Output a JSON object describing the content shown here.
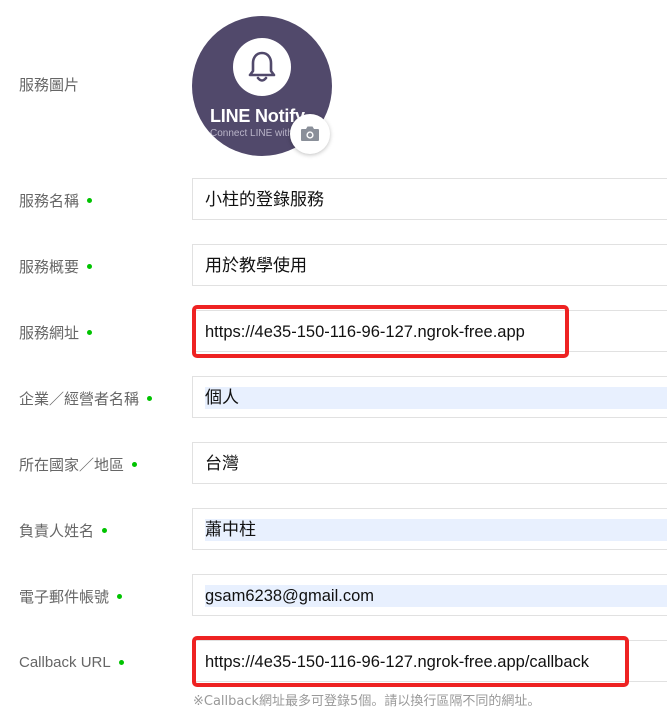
{
  "service_image": {
    "label": "服務圖片",
    "logo_text": "LINE Notify",
    "logo_tagline": "Connect LINE with Everything",
    "logo_icon": "bell-icon",
    "upload_icon": "camera-icon"
  },
  "fields": {
    "service_name": {
      "label": "服務名稱",
      "value": "小柱的登錄服務",
      "required": true
    },
    "service_summary": {
      "label": "服務概要",
      "value": "用於教學使用",
      "required": true
    },
    "service_url": {
      "label": "服務網址",
      "value": "https://4e35-150-116-96-127.ngrok-free.app",
      "required": true
    },
    "company_name": {
      "label": "企業／經營者名稱",
      "value": "個人",
      "required": true
    },
    "country": {
      "label": "所在國家／地區",
      "value": "台灣",
      "required": true
    },
    "contact_name": {
      "label": "負責人姓名",
      "value": "蕭中柱",
      "required": true
    },
    "email": {
      "label": "電子郵件帳號",
      "value": "gsam6238@gmail.com",
      "required": true
    },
    "callback_url": {
      "label": "Callback URL",
      "value": "https://4e35-150-116-96-127.ngrok-free.app/callback",
      "required": true
    }
  },
  "callback_note": "※Callback網址最多可登錄5個。請以換行區隔不同的網址。",
  "colors": {
    "required_dot": "#00c300",
    "highlight_border": "#ee2222",
    "avatar_bg": "#51496b",
    "autofill_bg": "#e8f0fe"
  }
}
